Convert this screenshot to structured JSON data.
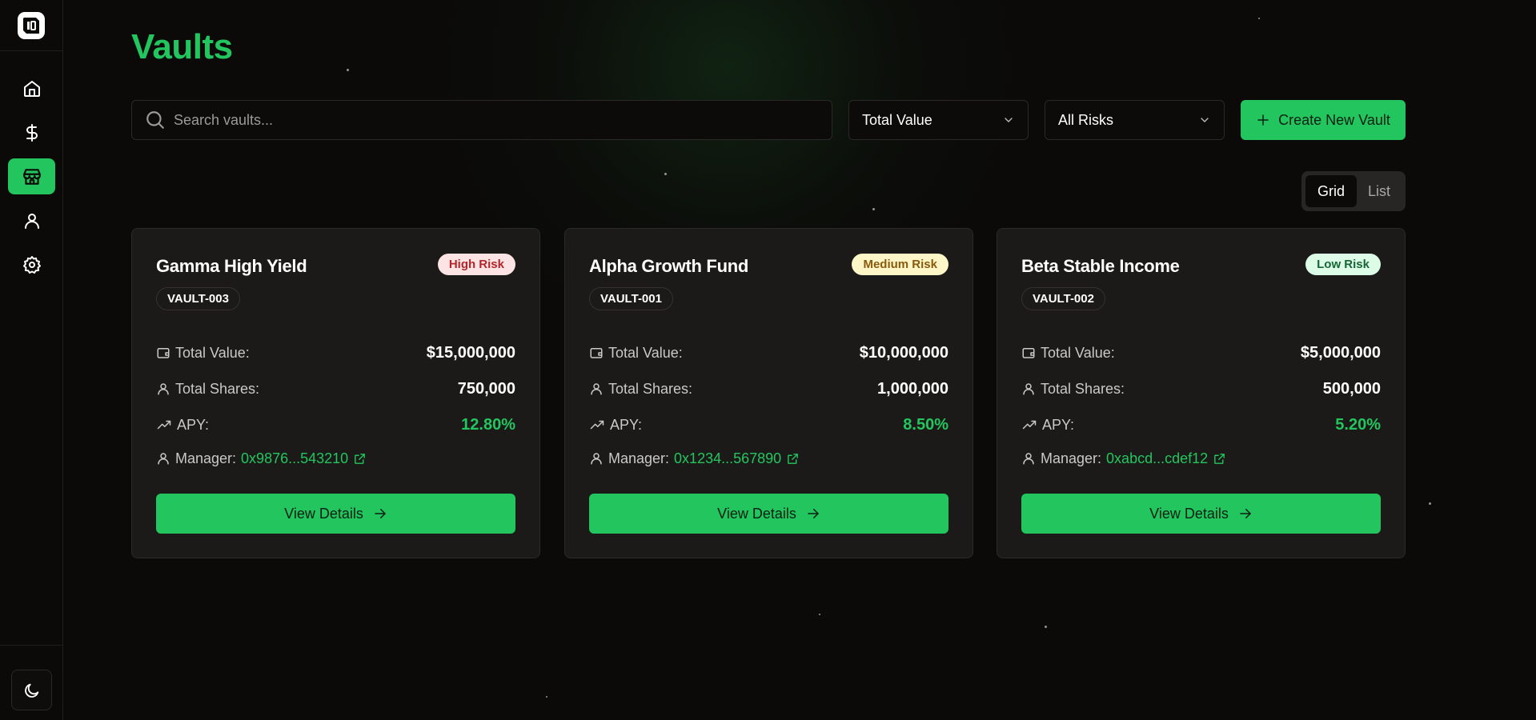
{
  "page": {
    "title": "Vaults"
  },
  "sidebar": {
    "logo": "logo-icon",
    "items": [
      {
        "name": "home",
        "icon": "home-icon",
        "active": false
      },
      {
        "name": "dollar",
        "icon": "dollar-icon",
        "active": false
      },
      {
        "name": "vaults",
        "icon": "store-icon",
        "active": true
      },
      {
        "name": "profile",
        "icon": "user-icon",
        "active": false
      },
      {
        "name": "settings",
        "icon": "gear-icon",
        "active": false
      }
    ],
    "theme_toggle_icon": "moon-icon"
  },
  "toolbar": {
    "search_placeholder": "Search vaults...",
    "sort_value": "Total Value",
    "risk_value": "All Risks",
    "create_label": "Create New Vault"
  },
  "view_toggle": {
    "grid_label": "Grid",
    "list_label": "List",
    "selected": "Grid"
  },
  "labels": {
    "total_value": "Total Value:",
    "total_shares": "Total Shares:",
    "apy": "APY:",
    "manager": "Manager:",
    "view_details": "View Details"
  },
  "colors": {
    "accent": "#22c55e",
    "background": "#0b0a09",
    "card": "#1c1a18"
  },
  "vaults": [
    {
      "name": "Gamma High Yield",
      "risk": "High Risk",
      "id": "VAULT-003",
      "total_value": "$15,000,000",
      "total_shares": "750,000",
      "apy": "12.80%",
      "manager": "0x9876...543210"
    },
    {
      "name": "Alpha Growth Fund",
      "risk": "Medium Risk",
      "id": "VAULT-001",
      "total_value": "$10,000,000",
      "total_shares": "1,000,000",
      "apy": "8.50%",
      "manager": "0x1234...567890"
    },
    {
      "name": "Beta Stable Income",
      "risk": "Low Risk",
      "id": "VAULT-002",
      "total_value": "$5,000,000",
      "total_shares": "500,000",
      "apy": "5.20%",
      "manager": "0xabcd...cdef12"
    }
  ]
}
